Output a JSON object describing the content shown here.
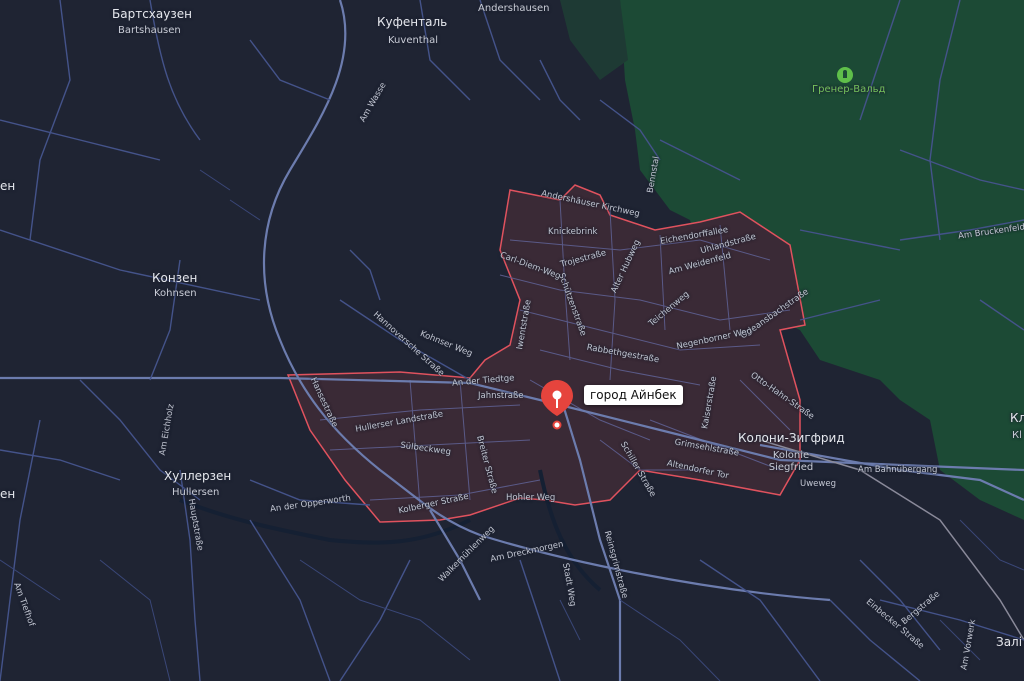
{
  "map": {
    "selected_place": "город Айнбек",
    "forest_name": "Гренер-Вальд",
    "places": [
      {
        "ru": "Бартсхаузен",
        "de": "Bartshausen"
      },
      {
        "ru": "Куфенталь",
        "de": "Kuventhal"
      },
      {
        "ru": "",
        "de": "Andershausen"
      },
      {
        "ru": "Конзен",
        "de": "Kohnsen"
      },
      {
        "ru": "Хуллерзен",
        "de": "Hullersen"
      },
      {
        "ru": "Колони-Зигфрид",
        "de": "Kolonie Siegfried"
      }
    ],
    "edge_fragments": [
      "ен",
      "ен",
      "Кл",
      "Кl",
      "Залі"
    ],
    "streets": [
      "Am Wasse",
      "Andershäuser Kirchweg",
      "Knickebrink",
      "Trojestraße",
      "Alter Hubweg",
      "Carl-Diem-Weg",
      "Eichendorffallee",
      "Uhlandstraße",
      "Am Weidenfeld",
      "Teichenweg",
      "Orleansbachstraße",
      "Negenborner Weg",
      "Rabbethgestraße",
      "Schützenstraße",
      "Hannoversche Straße",
      "Kohnser Weg",
      "Iwentstraße",
      "An der Tiedtge",
      "Jahnstraße",
      "Hansestraße",
      "Hullerser Landstraße",
      "Sülbeckweg",
      "Breiter Straße",
      "Kolberger Straße",
      "Hohler Weg",
      "Grimsehlstraße",
      "Altendorfer Tor",
      "Schiller Straße",
      "Otto-Hahn-Straße",
      "Kaiserstraße",
      "Am Bahnübergang",
      "Uweweg",
      "An der Opperworth",
      "Hauptstraße",
      "Am Eichholz",
      "Am Tiefhof",
      "Walkemühlenweg",
      "Am Dreckmorgen",
      "Stadt Weg",
      "Reinsgrimstraße",
      "Einbecker Straße",
      "Bergstraße",
      "Am Bruckenfeld",
      "Am Vorwerk",
      "Bennstal"
    ]
  },
  "colors": {
    "background": "#1f2433",
    "forest": "#1c4a35",
    "city_fill": "#3a2a36",
    "city_border": "#e0525e",
    "road": "#4a5a8a",
    "major_road": "#6c7cae",
    "pin": "#e6443d",
    "forest_label": "#74c25b"
  },
  "icons": [
    "map-pin-icon",
    "forest-icon"
  ]
}
